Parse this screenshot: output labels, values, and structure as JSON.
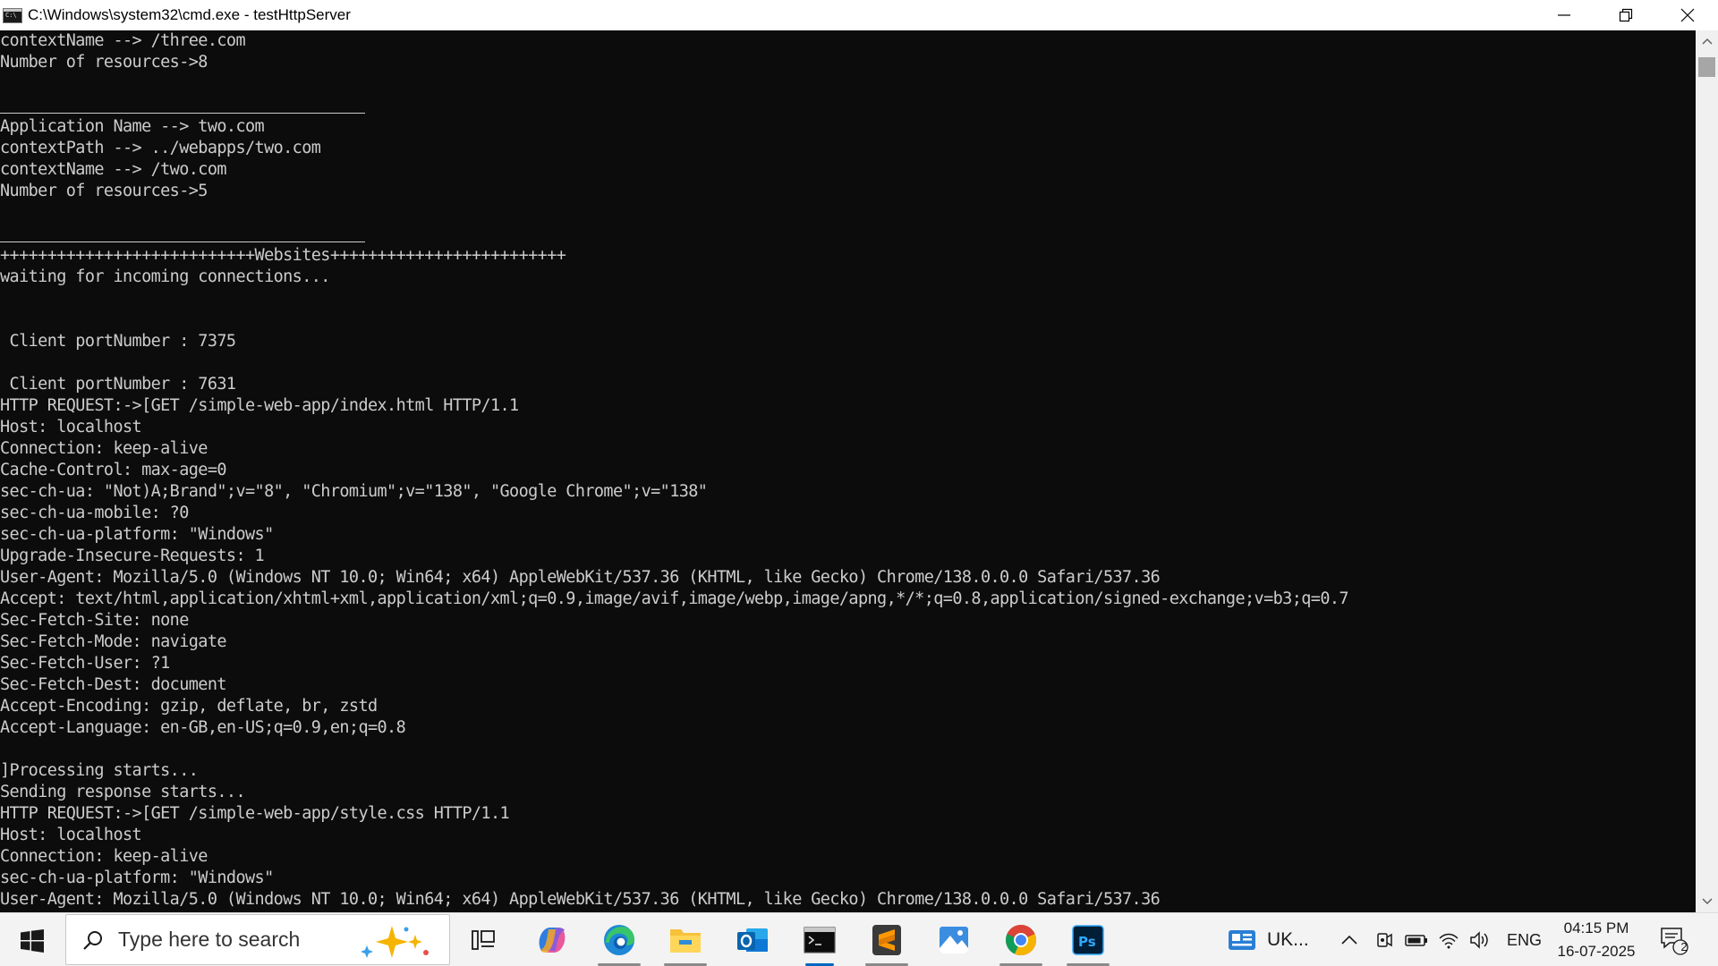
{
  "window": {
    "title": "C:\\Windows\\system32\\cmd.exe - testHttpServer",
    "icon": "cmd-icon",
    "controls": [
      "minimize-icon",
      "restore-icon",
      "close-icon"
    ]
  },
  "console": {
    "lines": [
      "contextName --> /three.com",
      "Number of resources->8",
      "",
      "__RULE__",
      "Application Name --> two.com",
      "contextPath --> ../webapps/two.com",
      "contextName --> /two.com",
      "Number of resources->5",
      "",
      "__RULE__",
      "+++++++++++++++++++++++++++Websites+++++++++++++++++++++++++",
      "waiting for incoming connections...",
      "",
      "",
      " Client portNumber : 7375",
      "",
      " Client portNumber : 7631",
      "HTTP REQUEST:->[GET /simple-web-app/index.html HTTP/1.1",
      "Host: localhost",
      "Connection: keep-alive",
      "Cache-Control: max-age=0",
      "sec-ch-ua: \"Not)A;Brand\";v=\"8\", \"Chromium\";v=\"138\", \"Google Chrome\";v=\"138\"",
      "sec-ch-ua-mobile: ?0",
      "sec-ch-ua-platform: \"Windows\"",
      "Upgrade-Insecure-Requests: 1",
      "User-Agent: Mozilla/5.0 (Windows NT 10.0; Win64; x64) AppleWebKit/537.36 (KHTML, like Gecko) Chrome/138.0.0.0 Safari/537.36",
      "Accept: text/html,application/xhtml+xml,application/xml;q=0.9,image/avif,image/webp,image/apng,*/*;q=0.8,application/signed-exchange;v=b3;q=0.7",
      "Sec-Fetch-Site: none",
      "Sec-Fetch-Mode: navigate",
      "Sec-Fetch-User: ?1",
      "Sec-Fetch-Dest: document",
      "Accept-Encoding: gzip, deflate, br, zstd",
      "Accept-Language: en-GB,en-US;q=0.9,en;q=0.8",
      "",
      "]Processing starts...",
      "Sending response starts...",
      "HTTP REQUEST:->[GET /simple-web-app/style.css HTTP/1.1",
      "Host: localhost",
      "Connection: keep-alive",
      "sec-ch-ua-platform: \"Windows\"",
      "User-Agent: Mozilla/5.0 (Windows NT 10.0; Win64; x64) AppleWebKit/537.36 (KHTML, like Gecko) Chrome/138.0.0.0 Safari/537.36"
    ]
  },
  "taskbar": {
    "search_placeholder": "Type here to search",
    "apps": [
      {
        "name": "task-view-icon",
        "active": false
      },
      {
        "name": "copilot-icon",
        "active": false
      },
      {
        "name": "edge-icon",
        "active": false,
        "running": true
      },
      {
        "name": "file-explorer-icon",
        "active": false,
        "running": true
      },
      {
        "name": "outlook-icon",
        "active": false
      },
      {
        "name": "command-prompt-icon",
        "active": true,
        "running": true
      },
      {
        "name": "sublime-text-icon",
        "active": false,
        "running": true
      },
      {
        "name": "photos-icon",
        "active": false
      },
      {
        "name": "chrome-icon",
        "active": false,
        "running": true
      },
      {
        "name": "photoshop-icon",
        "active": false,
        "running": true
      }
    ],
    "weather_text": "UK...",
    "language": "ENG",
    "time": "04:15 PM",
    "date": "16-07-2025",
    "notification_count": "2"
  }
}
